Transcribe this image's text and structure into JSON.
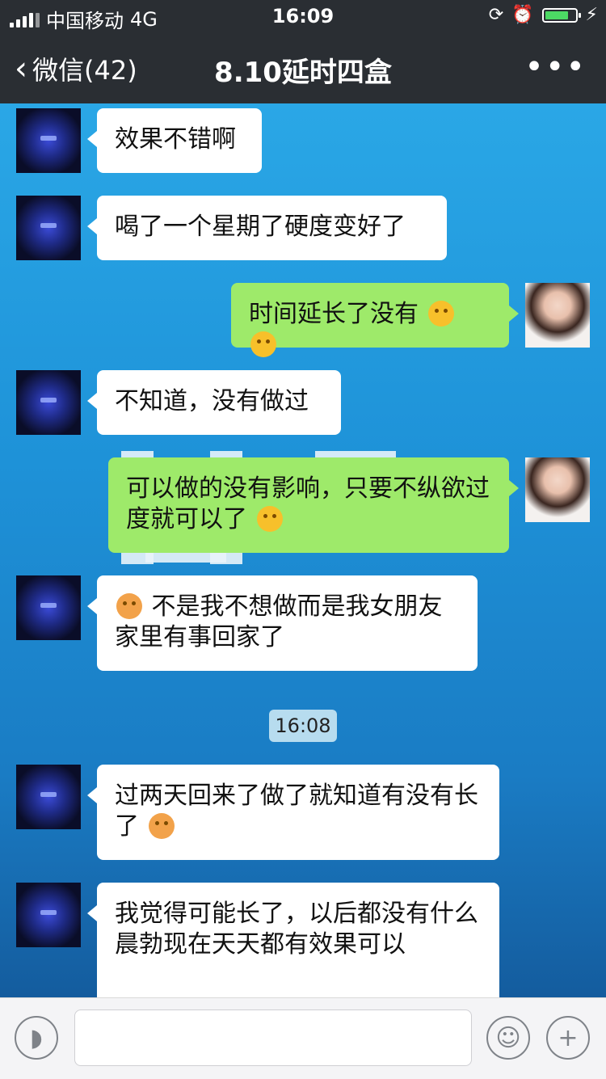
{
  "status_bar": {
    "carrier": "中国移动",
    "network": "4G",
    "time": "16:09"
  },
  "nav": {
    "back_label": "微信(42)",
    "title": "8.10延时四盒",
    "more": "•••"
  },
  "messages": [
    {
      "side": "left",
      "text": "效果不错啊"
    },
    {
      "side": "left",
      "text": "喝了一个星期了硬度变好了"
    },
    {
      "side": "right",
      "text": "时间延长了没有"
    },
    {
      "side": "left",
      "text": "不知道，没有做过"
    },
    {
      "side": "right",
      "text": "可以做的没有影响，只要不纵欲过度就可以了"
    },
    {
      "side": "left",
      "text": "不是我不想做而是我女朋友家里有事回家了"
    },
    {
      "side": "timestamp",
      "text": "16:08"
    },
    {
      "side": "left",
      "text": "过两天回来了做了就知道有没有长了"
    },
    {
      "side": "left",
      "text": "我觉得可能长了，以后都没有什么晨勃现在天天都有效果可以"
    }
  ],
  "input_bar": {
    "voice_icon": "voice-icon",
    "emoji_icon": "emoji-icon",
    "plus_icon": "plus-icon"
  },
  "colors": {
    "nav_bg": "#2a2e33",
    "bubble_right": "#9eea6a",
    "bubble_left": "#ffffff",
    "chat_bg": "#1f8fd6"
  }
}
